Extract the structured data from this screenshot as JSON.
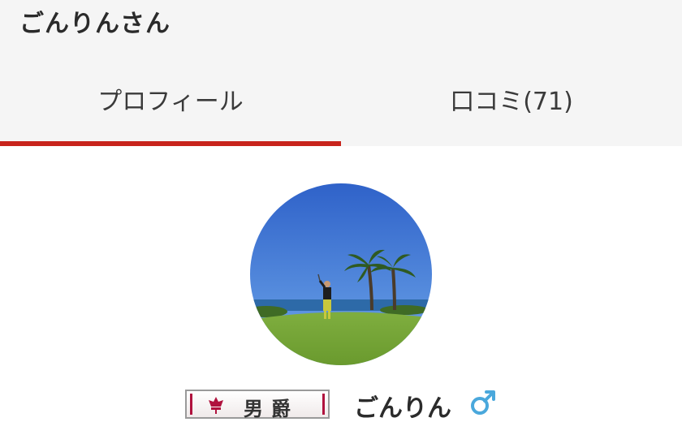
{
  "header": {
    "title": "ごんりんさん"
  },
  "tabs": [
    {
      "label": "プロフィール",
      "active": true
    },
    {
      "label": "口コミ(71)",
      "active": false
    }
  ],
  "profile": {
    "avatar_description": "golfer-on-green-with-palm-trees",
    "rank_label": "男爵",
    "username": "ごんりん",
    "gender_icon": "male-symbol-icon"
  },
  "colors": {
    "header_bg": "#f5f5f5",
    "active_tab_indicator": "#c8241c",
    "gender_icon": "#4aa8dc",
    "rank_accent": "#b0123e"
  }
}
